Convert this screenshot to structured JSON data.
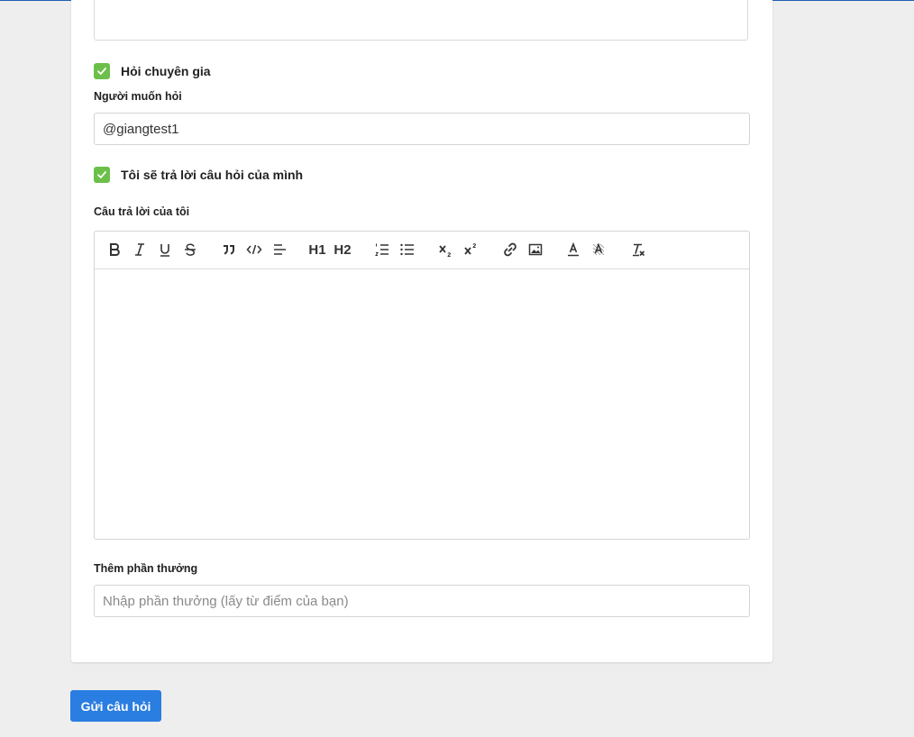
{
  "form": {
    "ask_expert": {
      "label": "Hỏi chuyên gia",
      "checked": true
    },
    "target_user": {
      "label": "Người muốn hỏi",
      "value": "@giangtest1"
    },
    "self_answer": {
      "label": "Tôi sẽ trả lời câu hỏi của mình",
      "checked": true
    },
    "answer": {
      "label": "Câu trả lời của tôi",
      "toolbar": {
        "h1_label": "H1",
        "h2_label": "H2",
        "buttons": [
          "bold-icon",
          "italic-icon",
          "underline-icon",
          "strike-icon",
          "blockquote-icon",
          "code-icon",
          "align-icon",
          "header-1-icon",
          "header-2-icon",
          "ordered-list-icon",
          "bullet-list-icon",
          "subscript-icon",
          "superscript-icon",
          "link-icon",
          "image-icon",
          "text-color-icon",
          "background-color-icon",
          "clear-format-icon"
        ]
      }
    },
    "reward": {
      "label": "Thêm phần thưởng",
      "placeholder": "Nhập phần thưởng (lấy từ điểm của bạn)"
    },
    "submit_label": "Gửi câu hỏi"
  },
  "colors": {
    "accent": "#2a7de1",
    "checkbox": "#6cc04a",
    "background": "#eeeeee"
  }
}
